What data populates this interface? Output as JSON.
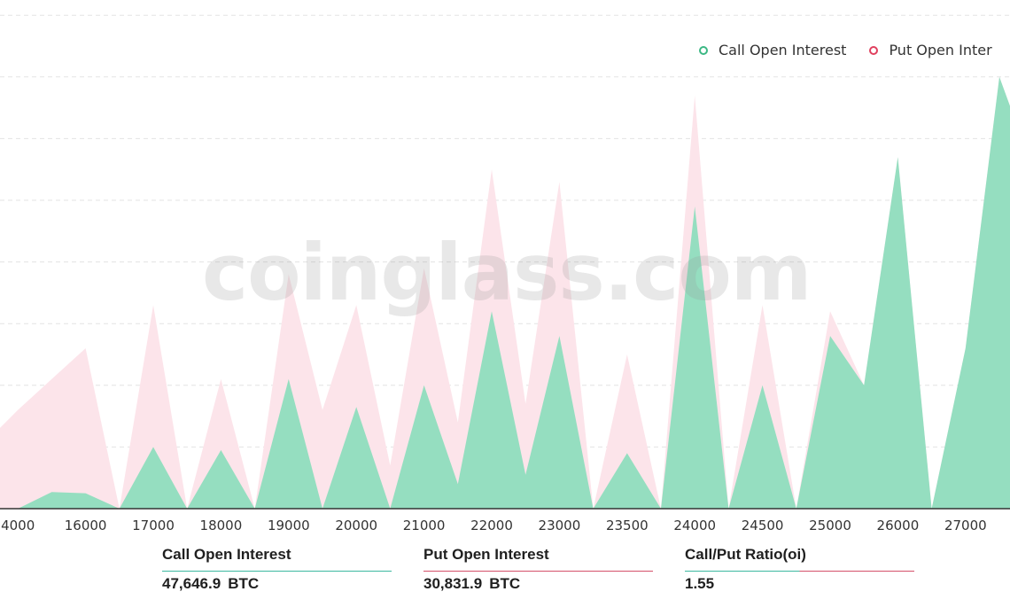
{
  "chart_data": {
    "type": "area",
    "title": "",
    "xlabel": "",
    "ylabel": "",
    "y_units": "relative (gridline units, no y-axis labels shown)",
    "ylim": [
      0,
      8
    ],
    "grid": true,
    "legend_position": "top-right",
    "watermark": "coinglass.com",
    "tick_labels": [
      "4000",
      "16000",
      "17000",
      "18000",
      "19000",
      "20000",
      "21000",
      "22000",
      "23000",
      "23500",
      "24000",
      "24500",
      "25000",
      "26000",
      "27000"
    ],
    "tick_label_point_index": [
      1,
      3,
      5,
      7,
      9,
      11,
      13,
      15,
      17,
      19,
      21,
      23,
      25,
      27,
      29
    ],
    "point_count": 32,
    "series": [
      {
        "name": "Put  Open Interest",
        "color": "#fce4ea",
        "legend_color": "#e0405e",
        "values": [
          1.05,
          1.6,
          2.1,
          2.6,
          0,
          3.3,
          0,
          2.1,
          0,
          3.8,
          1.6,
          3.3,
          0.7,
          3.9,
          1.4,
          5.5,
          1.7,
          5.3,
          0,
          2.5,
          0,
          6.7,
          0,
          3.3,
          0,
          3.2,
          2.0,
          5.7,
          0,
          2.6,
          7.0,
          5.5
        ]
      },
      {
        "name": "Call Open Interest",
        "color": "#95dec0",
        "legend_color": "#3cb884",
        "values": [
          0,
          0,
          0.27,
          0.25,
          0,
          1.0,
          0,
          0.95,
          0,
          2.1,
          0,
          1.65,
          0,
          2.0,
          0.4,
          3.2,
          0.55,
          2.8,
          0,
          0.9,
          0,
          4.9,
          0,
          2.0,
          0,
          2.8,
          2.0,
          5.7,
          0,
          2.6,
          7.0,
          5.5
        ]
      }
    ]
  },
  "legend": {
    "items": [
      {
        "label": "Call Open Interest",
        "color": "#3cb884"
      },
      {
        "label": "Put  Open Inter",
        "color": "#e0405e"
      }
    ]
  },
  "stats": [
    {
      "title": "Call Open Interest",
      "value": "47,646.9",
      "unit": "BTC",
      "line": [
        "#3cb8a0",
        "#3cb8a0"
      ]
    },
    {
      "title": "Put Open Interest",
      "value": "30,831.9",
      "unit": "BTC",
      "line": [
        "#d4506a",
        "#d4506a"
      ]
    },
    {
      "title": "Call/Put Ratio(oi)",
      "value": "1.55",
      "unit": "",
      "line": [
        "#3cb8a0",
        "#d4506a"
      ]
    }
  ]
}
